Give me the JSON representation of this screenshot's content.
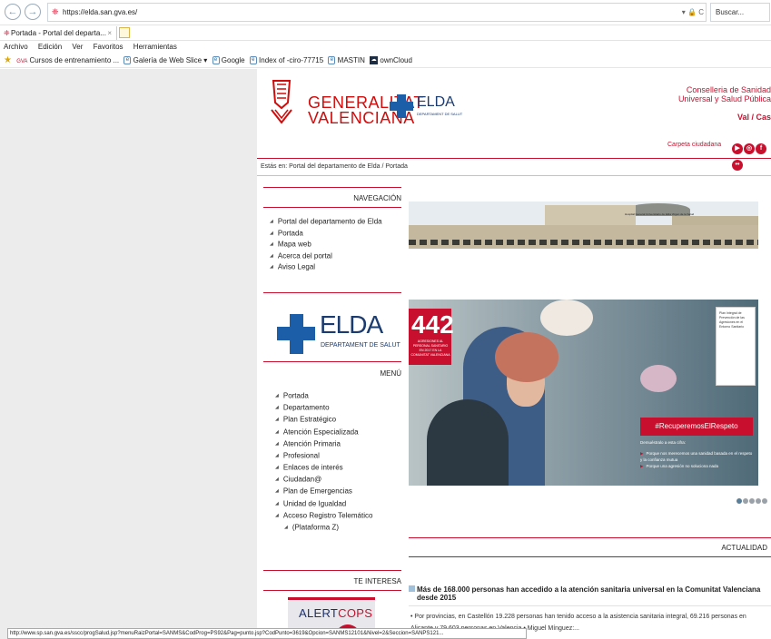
{
  "browser": {
    "url": "https://elda.san.gva.es/",
    "search_placeholder": "Buscar...",
    "tab_title": "Portada - Portal del departa...",
    "tab_close": "×",
    "back_icon": "back-arrow",
    "forward_icon": "forward-arrow",
    "menu": [
      "Archivo",
      "Edición",
      "Ver",
      "Favoritos",
      "Herramientas"
    ],
    "favorites": [
      {
        "label": "Cursos de entrenamiento ...",
        "prefix": "GVA"
      },
      {
        "label": "Galería de Web Slice ▾"
      },
      {
        "label": "Google"
      },
      {
        "label": "Index of -ciro-77715"
      },
      {
        "label": "MASTIN"
      },
      {
        "label": "ownCloud"
      }
    ],
    "status_url": "http://www.sp.san.gva.es/sscc/progSalud.jsp?menuRaizPortal=SANMS&CodProg=PS92&Pag=punto.jsp?CodPunto=3619&Opcion=SANMS12101&Nivel=2&Seccion=SANPS121..."
  },
  "header": {
    "gva_line1": "GENERALITAT",
    "gva_line2": "VALENCIANA",
    "elda_name": "ELDA",
    "elda_sub": "DEPARTAMENT DE SALUT",
    "conselleria": "Conselleria de Sanidad Universal y Salud Pública",
    "lang": "Val / Cas",
    "carpeta": "Carpeta ciudadana",
    "social": [
      "▶",
      "◎",
      "f",
      "••"
    ]
  },
  "breadcrumb": "Estás en:  Portal del departamento de Elda  /  Portada",
  "navegacion": {
    "title": "NAVEGACIÓN",
    "items": [
      "Portal del departamento de Elda",
      "Portada",
      "Mapa web",
      "Acerca del portal",
      "Aviso Legal"
    ]
  },
  "elda_block": {
    "name": "ELDA",
    "sub": "DEPARTAMENT DE SALUT"
  },
  "menu": {
    "title": "MENÚ",
    "items": [
      "Portada",
      "Departamento",
      "Plan Estratégico",
      "Atención Especializada",
      "Atención Primaria",
      "Profesional",
      "Enlaces de interés",
      "Ciudadan@",
      "Plan de Emergencias",
      "Unidad de Igualdad",
      "Acceso Registro Telemático",
      "(Plataforma Z)"
    ]
  },
  "te_interesa": {
    "title": "TE INTERESA",
    "alert_part1": "ALERT",
    "alert_part2": "COPS"
  },
  "hospital_sign": "Hospital General Universitario de Elda Virgen de la Salud",
  "banner": {
    "number": "442",
    "red_sub": "AGRESIONES AL PERSONAL SANITARIO EN 2017 EN LA COMUNITAT VALENCIANA",
    "side_card": "Plan Integral de Prevención de las Agresiones en el Entorno Sanitario",
    "hashtag": "#RecuperemosElRespeto",
    "demuestra": "Demuéstralo a esta cifra:",
    "bullets": [
      "Porque nos merecemos una sanidad basada en el respeto y la confianza mutua",
      "Porque una agresión no soluciona nada"
    ]
  },
  "actualidad": {
    "title": "ACTUALIDAD",
    "news_title": "Más de 168.000 personas han accedido a la atención sanitaria universal en la Comunitat Valenciana desde 2015",
    "news_body": "• Por provincias, en Castellón 19.228 personas han tenido acceso a la asistencia sanitaria integral, 69.216 personas en Alicante y 79.603 personas en Valencia • Miguel Mínguez:..."
  },
  "colors": {
    "gva_red": "#c8102e",
    "elda_blue": "#1c5fa8",
    "left_bg": "#ececec"
  }
}
